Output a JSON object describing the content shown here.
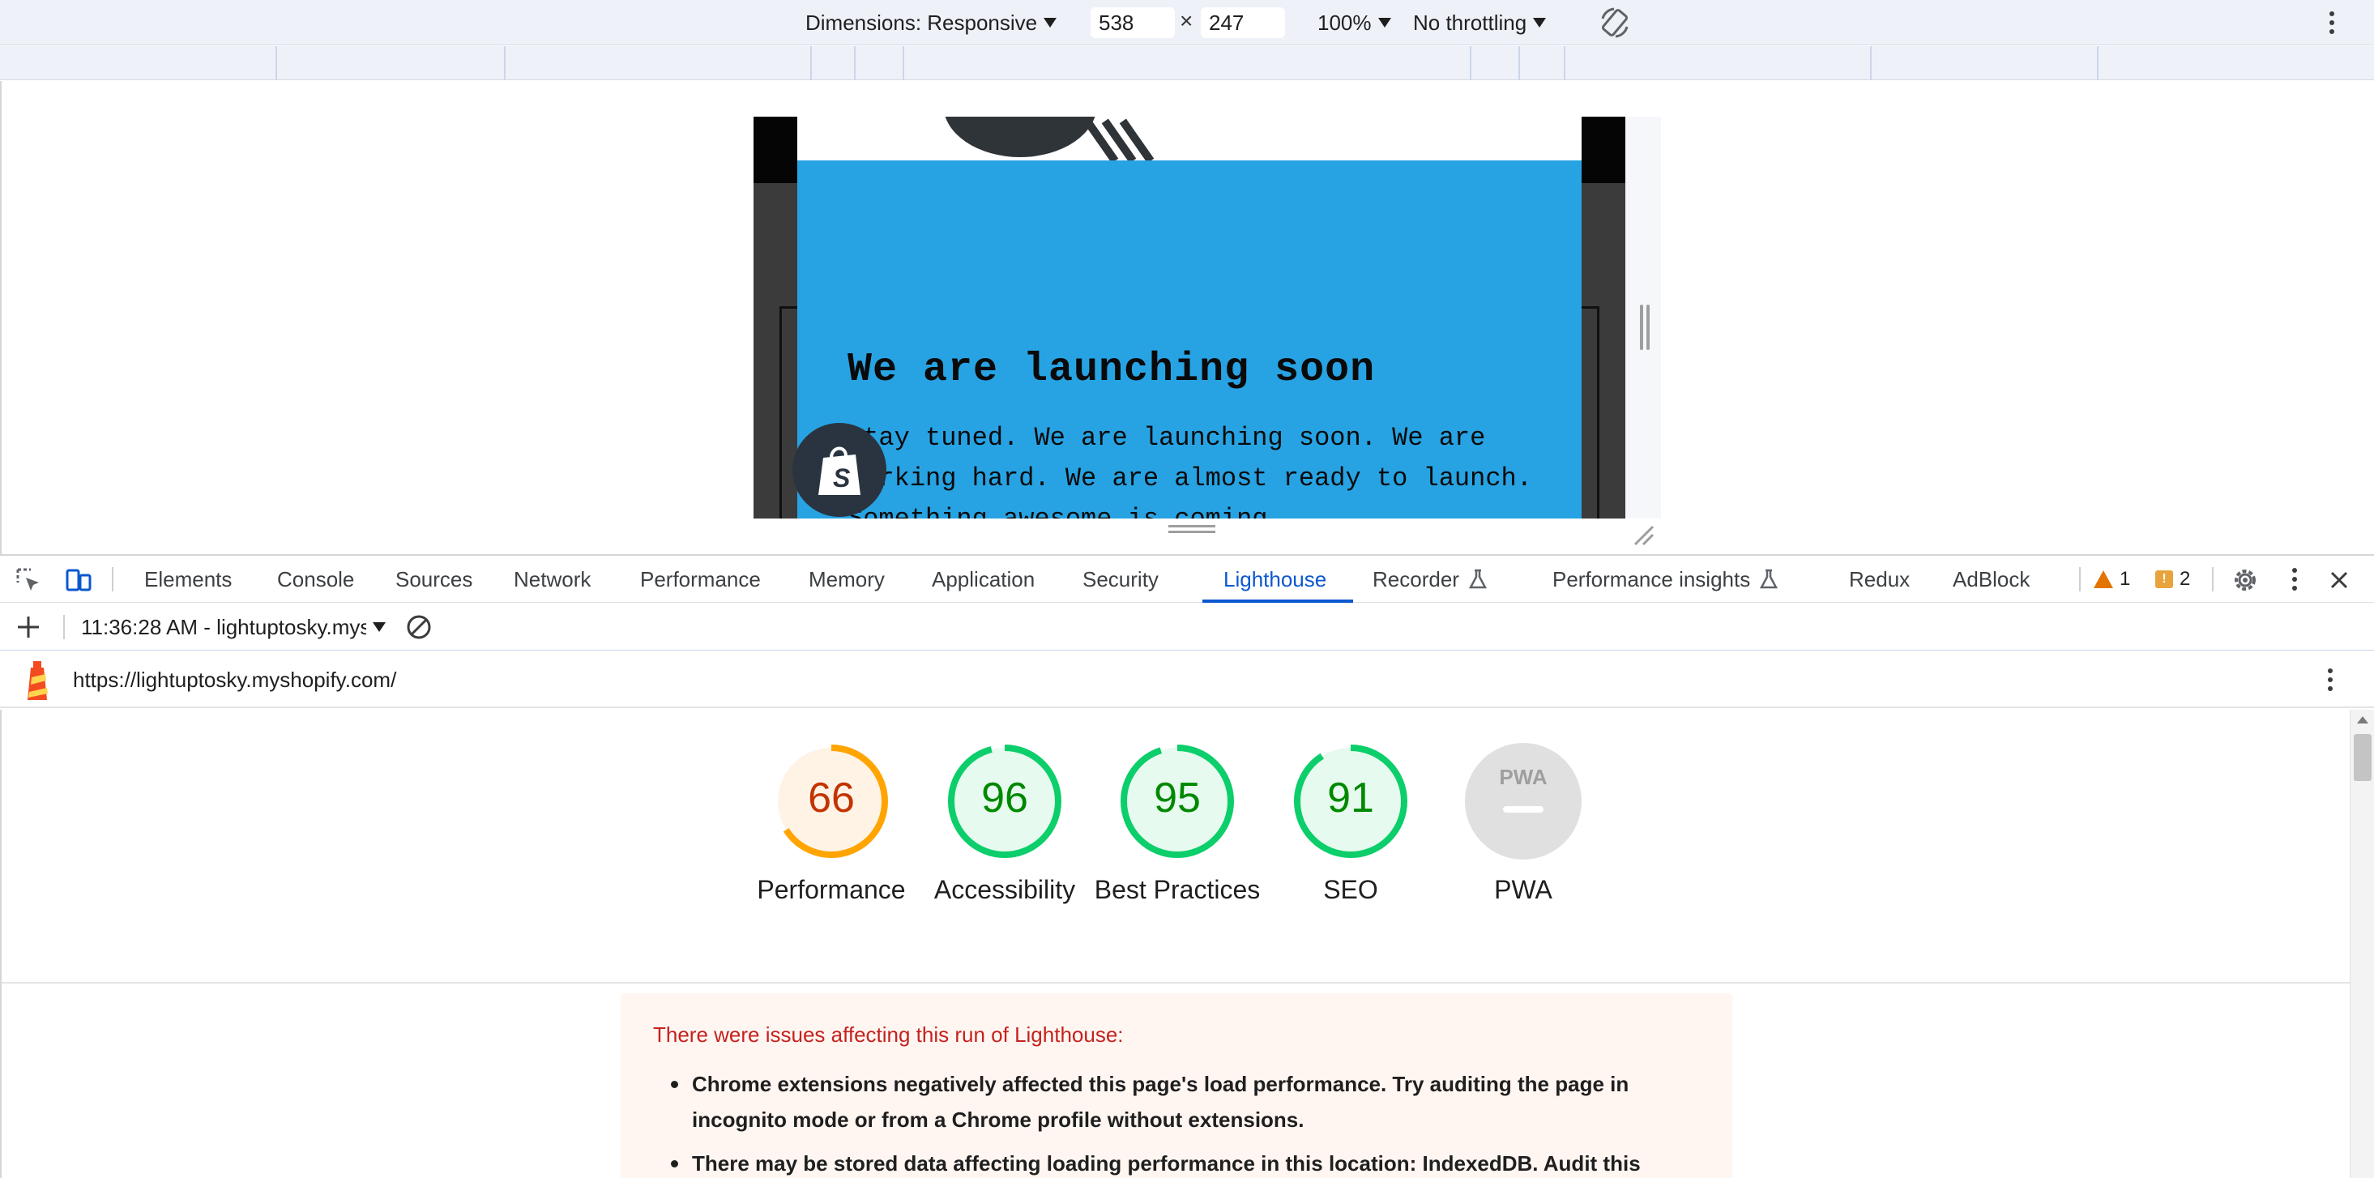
{
  "device_toolbar": {
    "dimensions_label": "Dimensions: Responsive",
    "width": "538",
    "times": "×",
    "height": "247",
    "zoom": "100%",
    "throttling": "No throttling"
  },
  "viewport": {
    "popup_title": "We are launching soon",
    "popup_text": "Stay tuned. We are launching soon. We are working hard. We are almost ready to launch. Something awesome is coming",
    "popup_color": "#27a3e3"
  },
  "devtools": {
    "tabs": [
      {
        "label": "Elements"
      },
      {
        "label": "Console"
      },
      {
        "label": "Sources"
      },
      {
        "label": "Network"
      },
      {
        "label": "Performance"
      },
      {
        "label": "Memory"
      },
      {
        "label": "Application"
      },
      {
        "label": "Security"
      },
      {
        "label": "Lighthouse"
      },
      {
        "label": "Recorder"
      },
      {
        "label": "Performance insights"
      },
      {
        "label": "Redux"
      },
      {
        "label": "AdBlock"
      }
    ],
    "active_tab": "Lighthouse",
    "warnings_count": "1",
    "issues_count": "2"
  },
  "lighthouse": {
    "report_select": "11:36:28 AM - lightuptosky.myshopify.com",
    "url": "https://lightuptosky.myshopify.com/",
    "scores": [
      {
        "value": 66,
        "label": "Performance",
        "status": "average",
        "color": "#e8710a"
      },
      {
        "value": 96,
        "label": "Accessibility",
        "status": "pass",
        "color": "#0cce6b"
      },
      {
        "value": 95,
        "label": "Best Practices",
        "status": "pass",
        "color": "#0cce6b"
      },
      {
        "value": 91,
        "label": "SEO",
        "status": "pass",
        "color": "#0cce6b"
      },
      {
        "label": "PWA",
        "badge": "PWA"
      }
    ],
    "warning": {
      "title": "There were issues affecting this run of Lighthouse:",
      "items": [
        "Chrome extensions negatively affected this page's load performance. Try auditing the page in incognito mode or from a Chrome profile without extensions.",
        "There may be stored data affecting loading performance in this location: IndexedDB. Audit this"
      ]
    }
  }
}
